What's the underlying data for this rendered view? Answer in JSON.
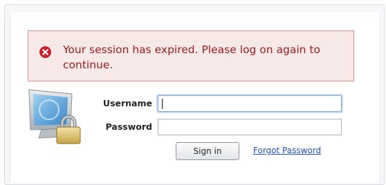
{
  "error": {
    "icon": "error-circle-x-icon",
    "message": "Your session has expired. Please log on again to continue.",
    "color": "#9a1a1a",
    "background": "#f8e9e9",
    "border": "#d99090"
  },
  "login": {
    "icon": "computer-lock-icon",
    "username_label": "Username",
    "username_value": "",
    "password_label": "Password",
    "password_value": "",
    "signin_label": "Sign in",
    "forgot_label": "Forgot Password"
  },
  "colors": {
    "link": "#1a4fc4",
    "focus_ring": "#7fa9d9"
  }
}
